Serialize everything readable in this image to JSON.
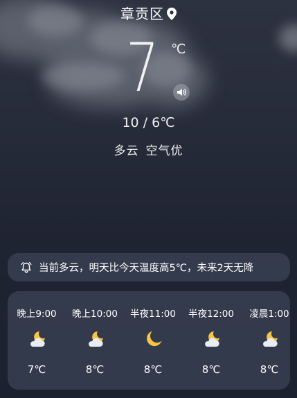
{
  "location": {
    "name": "章贡区"
  },
  "current": {
    "temperature": "7",
    "unit": "℃",
    "range": "10 / 6℃",
    "condition": "多云",
    "air_quality": "空气优"
  },
  "alert": {
    "text": "当前多云，明天比今天温度高5℃，未来2天无降"
  },
  "hourly": [
    {
      "time": "晚上9:00",
      "icon": "moon-cloud-icon",
      "temp": "7℃"
    },
    {
      "time": "晚上10:00",
      "icon": "moon-cloud-icon",
      "temp": "8℃"
    },
    {
      "time": "半夜11:00",
      "icon": "moon-icon",
      "temp": "8℃"
    },
    {
      "time": "半夜12:00",
      "icon": "moon-cloud-icon",
      "temp": "8℃"
    },
    {
      "time": "凌晨1:00",
      "icon": "moon-cloud-icon",
      "temp": "8℃"
    }
  ],
  "colors": {
    "background": "#232838",
    "card": "#3c4354",
    "moon": "#f7c543"
  }
}
